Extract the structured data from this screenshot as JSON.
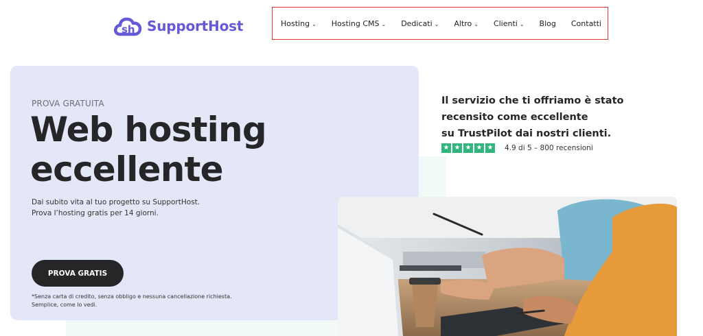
{
  "brand": {
    "name": "SupportHost",
    "color": "#6659d6"
  },
  "nav": {
    "items": [
      {
        "label": "Hosting",
        "has_dropdown": true
      },
      {
        "label": "Hosting CMS",
        "has_dropdown": true
      },
      {
        "label": "Dedicati",
        "has_dropdown": true
      },
      {
        "label": "Altro",
        "has_dropdown": true
      },
      {
        "label": "Clienti",
        "has_dropdown": true
      },
      {
        "label": "Blog",
        "has_dropdown": false
      },
      {
        "label": "Contatti",
        "has_dropdown": false
      }
    ],
    "highlight_color": "#e53935"
  },
  "hero": {
    "eyebrow": "PROVA GRATUITA",
    "title_line1": "Web hosting",
    "title_line2": "eccellente",
    "subtitle_line1": "Dai subito vita al tuo progetto su SupportHost.",
    "subtitle_line2": "Prova l’hosting gratis per 14 giorni.",
    "cta_label": "PROVA GRATIS",
    "note_line1": "*Senza carta di credito, senza obbligo e nessuna cancellazione richiesta.",
    "note_line2": "Semplice, come lo vedi.",
    "bg_color": "#e3e7f7"
  },
  "review": {
    "line1": "Il servizio che ti offriamo è stato",
    "line2": "recensito come eccellente",
    "line3": "su TrustPilot dai nostri clienti.",
    "stars": 5,
    "star_color": "#2fb67c",
    "rating_text": "4.9 di 5 – 800 recensioni"
  },
  "photo": {
    "icon": "team-at-desk-photo"
  }
}
